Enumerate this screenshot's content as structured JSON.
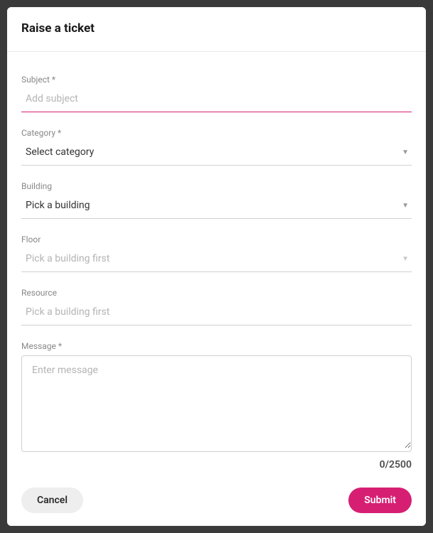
{
  "modal": {
    "title": "Raise a ticket"
  },
  "fields": {
    "subject": {
      "label": "Subject *",
      "placeholder": "Add subject",
      "value": ""
    },
    "category": {
      "label": "Category *",
      "selected": "Select category"
    },
    "building": {
      "label": "Building",
      "selected": "Pick a building"
    },
    "floor": {
      "label": "Floor",
      "selected": "Pick a building first"
    },
    "resource": {
      "label": "Resource",
      "placeholder": "Pick a building first",
      "value": ""
    },
    "message": {
      "label": "Message *",
      "placeholder": "Enter message",
      "value": "",
      "char_count": "0/2500"
    }
  },
  "buttons": {
    "cancel": "Cancel",
    "submit": "Submit"
  }
}
